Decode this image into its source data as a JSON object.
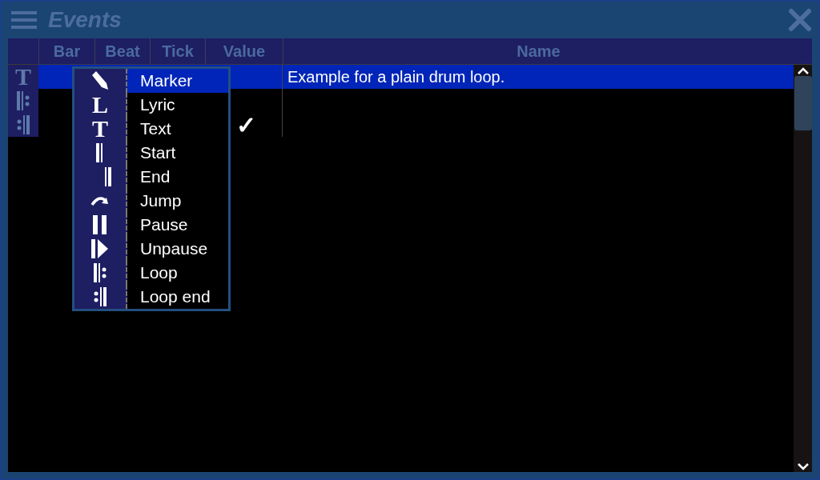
{
  "window": {
    "title": "Events"
  },
  "table": {
    "columns": [
      "Bar",
      "Beat",
      "Tick",
      "Value",
      "Name"
    ],
    "rows": [
      {
        "kind": "text",
        "glyph": "T",
        "selected": true,
        "value": "",
        "name": "Example for a plain drum loop."
      },
      {
        "kind": "loop",
        "selected": false,
        "value": "",
        "name": ""
      },
      {
        "kind": "loop_end",
        "selected": false,
        "value": "✓",
        "name": ""
      }
    ]
  },
  "menu": {
    "items": [
      {
        "kind": "marker",
        "label": "Marker",
        "selected": true
      },
      {
        "kind": "glyph",
        "glyph": "L",
        "label": "Lyric",
        "selected": false
      },
      {
        "kind": "glyph",
        "glyph": "T",
        "label": "Text",
        "selected": false
      },
      {
        "kind": "start",
        "label": "Start",
        "selected": false
      },
      {
        "kind": "end",
        "label": "End",
        "selected": false
      },
      {
        "kind": "jump",
        "label": "Jump",
        "selected": false
      },
      {
        "kind": "pause",
        "label": "Pause",
        "selected": false
      },
      {
        "kind": "unpause",
        "label": "Unpause",
        "selected": false
      },
      {
        "kind": "loop",
        "label": "Loop",
        "selected": false
      },
      {
        "kind": "loop_end",
        "label": "Loop end",
        "selected": false
      }
    ]
  }
}
